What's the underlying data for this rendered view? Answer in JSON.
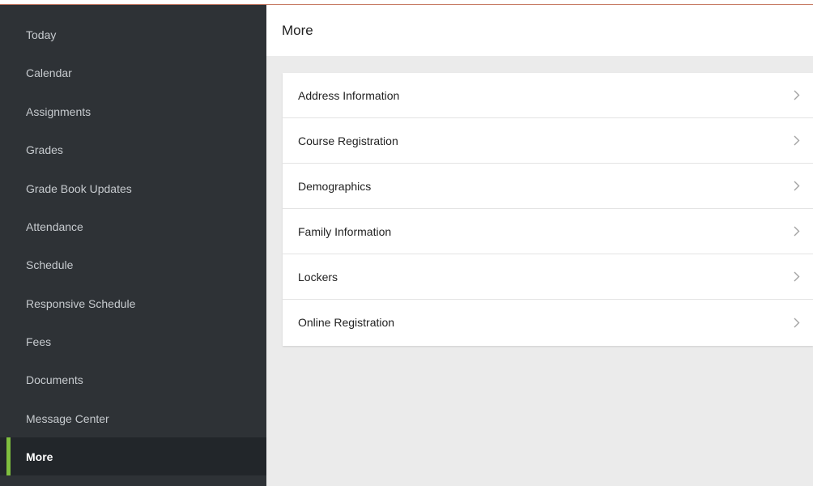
{
  "sidebar": {
    "items": [
      {
        "label": "Today"
      },
      {
        "label": "Calendar"
      },
      {
        "label": "Assignments"
      },
      {
        "label": "Grades"
      },
      {
        "label": "Grade Book Updates"
      },
      {
        "label": "Attendance"
      },
      {
        "label": "Schedule"
      },
      {
        "label": "Responsive Schedule"
      },
      {
        "label": "Fees"
      },
      {
        "label": "Documents"
      },
      {
        "label": "Message Center"
      },
      {
        "label": "More"
      }
    ],
    "active": "More",
    "accent_color": "#7fbf3f"
  },
  "header": {
    "title": "More"
  },
  "more_list": {
    "items": [
      {
        "label": "Address Information",
        "icon": "chevron-right-icon"
      },
      {
        "label": "Course Registration",
        "icon": "chevron-right-icon"
      },
      {
        "label": "Demographics",
        "icon": "chevron-right-icon"
      },
      {
        "label": "Family Information",
        "icon": "chevron-right-icon"
      },
      {
        "label": "Lockers",
        "icon": "chevron-right-icon"
      },
      {
        "label": "Online Registration",
        "icon": "chevron-right-icon"
      }
    ]
  }
}
